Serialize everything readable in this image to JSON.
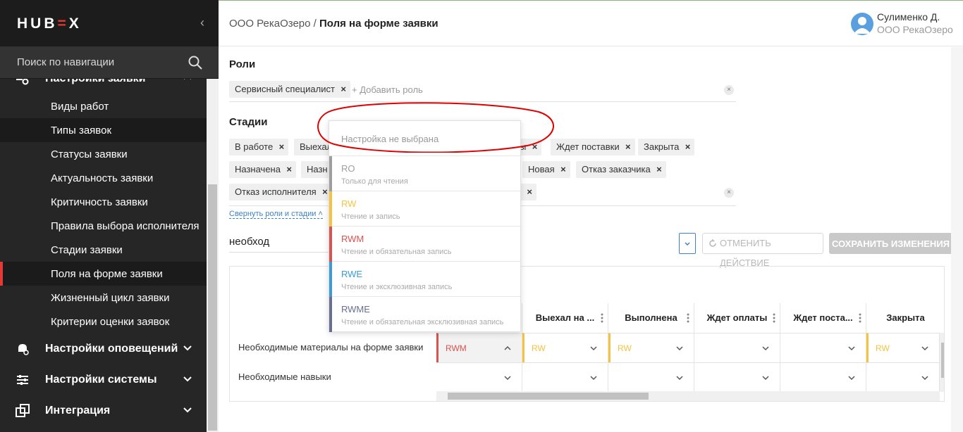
{
  "app": {
    "logo": "HUBEX"
  },
  "nav_search": {
    "placeholder": "Поиск по навигации"
  },
  "sidebar": {
    "groups": [
      {
        "label": "Настройки заявки"
      },
      {
        "label": "Настройки оповещений"
      },
      {
        "label": "Настройки системы"
      },
      {
        "label": "Интеграция"
      }
    ],
    "items": [
      {
        "label": "Виды работ"
      },
      {
        "label": "Типы заявок"
      },
      {
        "label": "Статусы заявки"
      },
      {
        "label": "Актуальность заявки"
      },
      {
        "label": "Критичность заявки"
      },
      {
        "label": "Правила выбора исполнителя"
      },
      {
        "label": "Стадии заявки"
      },
      {
        "label": "Поля на форме заявки"
      },
      {
        "label": "Жизненный цикл заявки"
      },
      {
        "label": "Критерии оценки заявок"
      }
    ],
    "active_item": "Поля на форме заявки"
  },
  "header": {
    "breadcrumb_org": "ООО РекаОзеро",
    "breadcrumb_sep": "/",
    "breadcrumb_page": "Поля на форме заявки",
    "user_name": "Сулименко Д.",
    "user_org": "ООО РекаОзеро"
  },
  "roles": {
    "title": "Роли",
    "tags": [
      "Сервисный специалист"
    ],
    "add_label": "+ Добавить роль"
  },
  "stages": {
    "title": "Стадии",
    "tags_row1": [
      "В работе",
      "Выехал",
      "ы",
      "Ждет поставки",
      "Закрыта"
    ],
    "tags_row2": [
      "Назначена",
      "Назн",
      "Новая",
      "Отказ заказчика"
    ],
    "tags_row3": [
      "Отказ исполнителя",
      ""
    ]
  },
  "collapse_link": "Свернуть роли и стадии",
  "field_search": {
    "value": "необход"
  },
  "actions": {
    "undo_label": "ОТМЕНИТЬ ДЕЙСТВИЕ",
    "save_label": "СОХРАНИТЬ ИЗМЕНЕНИЯ"
  },
  "grid": {
    "columns": [
      "Выехал на ...",
      "Выполнена",
      "Ждет оплаты",
      "Ждет поста...",
      "Закрыта"
    ],
    "rows": [
      {
        "label": "Необходимые материалы на форме заявки",
        "values": [
          "RWM",
          "RW",
          "RW",
          "",
          "",
          "RW"
        ]
      },
      {
        "label": "Необходимые навыки",
        "values": [
          "",
          "",
          "",
          "",
          "",
          ""
        ]
      }
    ]
  },
  "dropdown": {
    "placeholder": "Настройка не выбрана",
    "options": [
      {
        "code": "RO",
        "desc": "Только для чтения",
        "color": "#9e9e9e"
      },
      {
        "code": "RW",
        "desc": "Чтение и запись",
        "color": "#f5c342"
      },
      {
        "code": "RWM",
        "desc": "Чтение и обязательная запись",
        "color": "#d9534f"
      },
      {
        "code": "RWE",
        "desc": "Чтение и эксклюзивная запись",
        "color": "#3b9bd6"
      },
      {
        "code": "RWME",
        "desc": "Чтение и обязательная эксклюзивная запись",
        "color": "#6a6f8f"
      }
    ]
  },
  "colors": {
    "accent": "#e53935",
    "link": "#3c82c8",
    "annotation": "#e00000"
  }
}
